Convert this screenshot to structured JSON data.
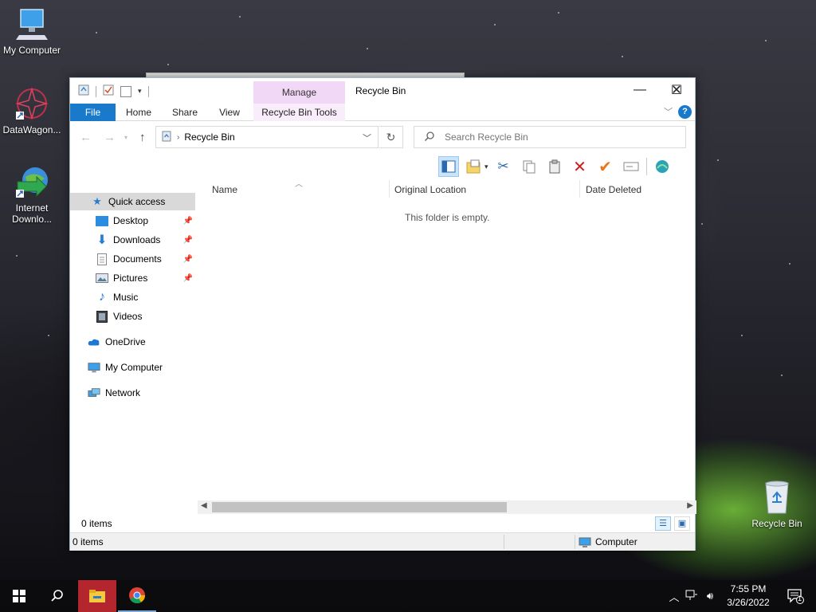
{
  "desktop": {
    "icons": [
      {
        "label": "My Computer"
      },
      {
        "label": "DataWagon..."
      },
      {
        "label": "Internet Downlo..."
      },
      {
        "label": "Recycle Bin"
      }
    ]
  },
  "window": {
    "title": "Recycle Bin",
    "manage_tab": "Manage",
    "tabs": {
      "file": "File",
      "home": "Home",
      "share": "Share",
      "view": "View",
      "tools": "Recycle Bin Tools"
    },
    "help": "?",
    "address": {
      "path": "Recycle Bin"
    },
    "search": {
      "placeholder": "Search Recycle Bin"
    },
    "nav": {
      "items": [
        {
          "label": "Quick access",
          "icon": "star-icon"
        },
        {
          "label": "Desktop",
          "icon": "desktop-folder-icon"
        },
        {
          "label": "Downloads",
          "icon": "download-arrow-icon"
        },
        {
          "label": "Documents",
          "icon": "document-icon"
        },
        {
          "label": "Pictures",
          "icon": "picture-icon"
        },
        {
          "label": "Music",
          "icon": "music-note-icon"
        },
        {
          "label": "Videos",
          "icon": "film-icon"
        },
        {
          "label": "OneDrive",
          "icon": "cloud-icon"
        },
        {
          "label": "My Computer",
          "icon": "computer-icon"
        },
        {
          "label": "Network",
          "icon": "network-icon"
        }
      ]
    },
    "columns": {
      "name": "Name",
      "original_location": "Original Location",
      "date_deleted": "Date Deleted"
    },
    "empty_message": "This folder is empty.",
    "status": {
      "items": "0 items"
    },
    "bottom": {
      "items": "0 items",
      "location": "Computer"
    }
  },
  "taskbar": {
    "time": "7:55 PM",
    "date": "3/26/2022",
    "notification_count": "1"
  },
  "colors": {
    "accent_blue": "#1979ca",
    "manage_tab": "#f2d8f7",
    "taskbar_active": "#b3262e"
  }
}
